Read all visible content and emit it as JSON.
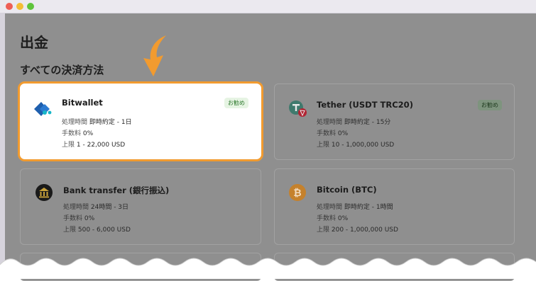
{
  "window": {
    "controls": [
      "close",
      "minimize",
      "maximize"
    ]
  },
  "page": {
    "title": "出金",
    "section_title": "すべての決済方法"
  },
  "labels": {
    "processing_time": "処理時間",
    "fee": "手数料",
    "limit": "上限"
  },
  "methods": [
    {
      "name": "Bitwallet",
      "badge": "お勧め",
      "time": "即時約定 - 1日",
      "fee": "0%",
      "limit": "1 - 22,000 USD",
      "icon": "bitwallet-logo-icon",
      "highlighted": true
    },
    {
      "name": "Tether (USDT TRC20)",
      "badge": "お勧め",
      "time": "即時約定 - 15分",
      "fee": "0%",
      "limit": "10 - 1,000,000 USD",
      "icon": "tether-trc20-icon",
      "highlighted": false
    },
    {
      "name": "Bank transfer (銀行振込)",
      "time": "24時間 - 3日",
      "fee": "0%",
      "limit": "500 - 6,000 USD",
      "icon": "bank-icon",
      "highlighted": false
    },
    {
      "name": "Bitcoin (BTC)",
      "time": "即時約定 - 1時間",
      "fee": "0%",
      "limit": "200 - 1,000,000 USD",
      "icon": "bitcoin-icon",
      "highlighted": false
    }
  ],
  "colors": {
    "highlight_border": "#f29b2f",
    "arrow": "#f29b2f",
    "overlay": "#8f8f8f",
    "badge_bg": "#e6f4e3",
    "badge_text": "#2f7a2f",
    "tether_green": "#3f7a6d",
    "tron_red": "#b22433",
    "bitcoin_orange": "#c5812c",
    "bitwallet_blue": "#1e5fae"
  }
}
